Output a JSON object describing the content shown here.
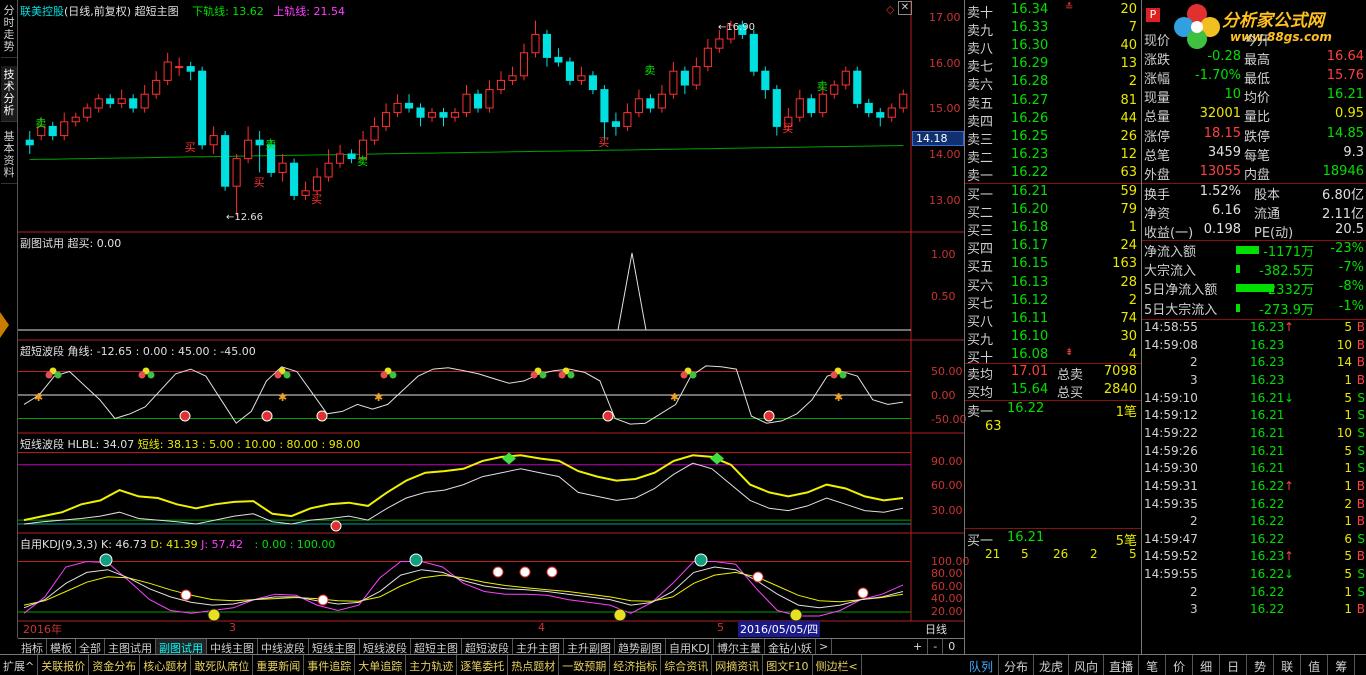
{
  "app": {
    "title": "联美控股",
    "subtitle": "(日线,前复权) 超短主图",
    "lower_label": "下轨线: 13.62",
    "upper_label": "上轨线: 21.54",
    "cur_price_tag": "14.18",
    "price_axis": [
      "17.00",
      "16.00",
      "15.00",
      "14.00",
      "13.00"
    ],
    "high_mark": "16.90",
    "low_mark": "12.66",
    "buy_sell": {
      "buy": "买",
      "sell": "卖"
    }
  },
  "left_tabs": [
    "分时走势",
    "技术分析",
    "基本资料"
  ],
  "panels": {
    "sub1": {
      "name": "副图试用",
      "value": "超买: 0.00",
      "axis": [
        "1.00",
        "0.50"
      ]
    },
    "sub2": {
      "name": "超短波段",
      "value": "角线: -12.65 : 0.00 : 45.00 : -45.00",
      "axis": [
        "50.00",
        "0.00",
        "-50.00"
      ]
    },
    "sub3": {
      "name": "短线波段",
      "value": "HLBL: 34.07",
      "value2": "短线: 38.13 : 5.00 : 10.00 : 80.00 : 98.00",
      "axis": [
        "90.00",
        "60.00",
        "30.00"
      ]
    },
    "sub4": {
      "name": "自用KDJ(9,3,3)",
      "k": "K: 46.73",
      "d": "D: 41.39",
      "j": "J: 57.42",
      "extra": ": 0.00 : 100.00",
      "axis": [
        "100.00",
        "80.00",
        "60.00",
        "40.00",
        "20.00"
      ]
    }
  },
  "time_axis": {
    "year": "2016年",
    "m3": "3",
    "m4": "4",
    "m5": "5",
    "date_box": "2016/05/05/四",
    "period": "日线"
  },
  "bottom_tabs": [
    "指标",
    "模板",
    "全部",
    "主图试用",
    "副图试用",
    "中线主图",
    "中线波段",
    "短线主图",
    "短线波段",
    "超短主图",
    "超短波段",
    "主升主图",
    "主升副图",
    "趋势副图",
    "自用KDJ",
    "博尔主量",
    "金钻小妖"
  ],
  "bottom_active": "副图试用",
  "status_bar": [
    "扩展^",
    "关联报价",
    "资金分布",
    "核心题材",
    "敢死队席位",
    "重要新闻",
    "事件追踪",
    "大单追踪",
    "主力轨迹",
    "逐笔委托",
    "热点题材",
    "一致预期",
    "经济指标",
    "综合资讯",
    "网摘资讯",
    "图文F10",
    "侧边栏<"
  ],
  "sell_orders": [
    {
      "label": "卖十",
      "price": "16.34",
      "vol": "20"
    },
    {
      "label": "卖九",
      "price": "16.33",
      "vol": "7"
    },
    {
      "label": "卖八",
      "price": "16.30",
      "vol": "40"
    },
    {
      "label": "卖七",
      "price": "16.29",
      "vol": "13"
    },
    {
      "label": "卖六",
      "price": "16.28",
      "vol": "2"
    },
    {
      "label": "卖五",
      "price": "16.27",
      "vol": "81"
    },
    {
      "label": "卖四",
      "price": "16.26",
      "vol": "44"
    },
    {
      "label": "卖三",
      "price": "16.25",
      "vol": "26"
    },
    {
      "label": "卖二",
      "price": "16.23",
      "vol": "12"
    },
    {
      "label": "卖一",
      "price": "16.22",
      "vol": "63"
    }
  ],
  "buy_orders": [
    {
      "label": "买一",
      "price": "16.21",
      "vol": "59"
    },
    {
      "label": "买二",
      "price": "16.20",
      "vol": "79"
    },
    {
      "label": "买三",
      "price": "16.18",
      "vol": "1"
    },
    {
      "label": "买四",
      "price": "16.17",
      "vol": "24"
    },
    {
      "label": "买五",
      "price": "16.15",
      "vol": "163"
    },
    {
      "label": "买六",
      "price": "16.13",
      "vol": "28"
    },
    {
      "label": "买七",
      "price": "16.12",
      "vol": "2"
    },
    {
      "label": "买八",
      "price": "16.11",
      "vol": "74"
    },
    {
      "label": "买九",
      "price": "16.10",
      "vol": "30"
    },
    {
      "label": "买十",
      "price": "16.08",
      "vol": "4"
    }
  ],
  "avg": {
    "sell_avg_label": "卖均",
    "sell_avg": "17.01",
    "total_sell_label": "总卖",
    "total_sell": "7098",
    "buy_avg_label": "买均",
    "buy_avg": "15.64",
    "total_buy_label": "总买",
    "total_buy": "2840"
  },
  "queue": {
    "sell1_label": "卖一",
    "sell1_price": "16.22",
    "sell1_count": "1笔",
    "sell1_vol": "63",
    "buy1_label": "买一",
    "buy1_price": "16.21",
    "buy1_count": "5笔",
    "buy1_vols": [
      "21",
      "5",
      "26",
      "2",
      "5"
    ]
  },
  "logo": {
    "text": "分析家公式网",
    "url": "www.88gs.com"
  },
  "stats": [
    {
      "l1": "现价",
      "v1": "",
      "l2": "今开",
      "v2": ""
    },
    {
      "l1": "涨跌",
      "v1": "-0.28",
      "l2": "最高",
      "v2": "16.64"
    },
    {
      "l1": "涨幅",
      "v1": "-1.70%",
      "l2": "最低",
      "v2": "15.76"
    },
    {
      "l1": "现量",
      "v1": "10",
      "l2": "均价",
      "v2": "16.21"
    },
    {
      "l1": "总量",
      "v1": "32001",
      "l2": "量比",
      "v2": "0.95"
    },
    {
      "l1": "涨停",
      "v1": "18.15",
      "l2": "跌停",
      "v2": "14.85"
    },
    {
      "l1": "总笔",
      "v1": "3459",
      "l2": "每笔",
      "v2": "9.3"
    },
    {
      "l1": "外盘",
      "v1": "13055",
      "l2": "内盘",
      "v2": "18946"
    }
  ],
  "stats2": [
    {
      "l1": "换手",
      "v1": "1.52%",
      "l2": "股本",
      "v2": "6.80亿"
    },
    {
      "l1": "净资",
      "v1": "6.16",
      "l2": "流通",
      "v2": "2.11亿"
    },
    {
      "l1": "收益(一)",
      "v1": "0.198",
      "l2": "PE(动)",
      "v2": "20.5"
    }
  ],
  "flows": [
    {
      "label": "净流入额",
      "value": "-1171万",
      "pct": "-23%",
      "bar": 0.6
    },
    {
      "label": "大宗流入",
      "value": "-382.5万",
      "pct": "-7%",
      "bar": 0.1
    },
    {
      "label": "5日净流入额",
      "value": "-2332万",
      "pct": "-8%",
      "bar": 1.0
    },
    {
      "label": "5日大宗流入",
      "value": "-273.9万",
      "pct": "-1%",
      "bar": 0.1
    }
  ],
  "ticks": [
    {
      "time": "14:58:55",
      "price": "16.23",
      "dir": "↑",
      "vol": "5",
      "side": "B"
    },
    {
      "time": "14:59:08",
      "price": "16.23",
      "dir": "",
      "vol": "10",
      "side": "B"
    },
    {
      "time": "2",
      "price": "16.23",
      "dir": "",
      "vol": "14",
      "side": "B"
    },
    {
      "time": "3",
      "price": "16.23",
      "dir": "",
      "vol": "1",
      "side": "B"
    },
    {
      "time": "14:59:10",
      "price": "16.21",
      "dir": "↓",
      "vol": "5",
      "side": "S"
    },
    {
      "time": "14:59:12",
      "price": "16.21",
      "dir": "",
      "vol": "1",
      "side": "S"
    },
    {
      "time": "14:59:22",
      "price": "16.21",
      "dir": "",
      "vol": "10",
      "side": "S"
    },
    {
      "time": "14:59:26",
      "price": "16.21",
      "dir": "",
      "vol": "5",
      "side": "S"
    },
    {
      "time": "14:59:30",
      "price": "16.21",
      "dir": "",
      "vol": "1",
      "side": "S"
    },
    {
      "time": "14:59:31",
      "price": "16.22",
      "dir": "↑",
      "vol": "1",
      "side": "B"
    },
    {
      "time": "14:59:35",
      "price": "16.22",
      "dir": "",
      "vol": "2",
      "side": "B"
    },
    {
      "time": "2",
      "price": "16.22",
      "dir": "",
      "vol": "1",
      "side": "B"
    },
    {
      "time": "14:59:47",
      "price": "16.22",
      "dir": "",
      "vol": "6",
      "side": "S"
    },
    {
      "time": "14:59:52",
      "price": "16.23",
      "dir": "↑",
      "vol": "5",
      "side": "B"
    },
    {
      "time": "14:59:55",
      "price": "16.22",
      "dir": "↓",
      "vol": "5",
      "side": "S"
    },
    {
      "time": "2",
      "price": "16.22",
      "dir": "",
      "vol": "1",
      "side": "S"
    },
    {
      "time": "3",
      "price": "16.22",
      "dir": "",
      "vol": "1",
      "side": "B"
    }
  ],
  "right_tabs": [
    "队列",
    "分布",
    "龙虎",
    "风向",
    "直播",
    "笔",
    "价",
    "细",
    "日",
    "势",
    "联",
    "值",
    "筹"
  ],
  "right_tab_active": "队列",
  "colors": {
    "up": "#ff4040",
    "down": "#00e0e0",
    "ma": "#00b000",
    "bg": "#000000"
  },
  "candles": [
    [
      14.3,
      14.2,
      14.5,
      14.0
    ],
    [
      14.4,
      14.6,
      14.8,
      14.3
    ],
    [
      14.6,
      14.4,
      14.7,
      14.3
    ],
    [
      14.4,
      14.7,
      14.9,
      14.3
    ],
    [
      14.7,
      14.8,
      14.9,
      14.6
    ],
    [
      14.8,
      15.0,
      15.1,
      14.7
    ],
    [
      15.0,
      15.2,
      15.3,
      14.9
    ],
    [
      15.2,
      15.1,
      15.3,
      15.0
    ],
    [
      15.1,
      15.2,
      15.4,
      15.0
    ],
    [
      15.2,
      15.0,
      15.3,
      14.9
    ],
    [
      15.0,
      15.3,
      15.5,
      14.9
    ],
    [
      15.3,
      15.6,
      15.8,
      15.2
    ],
    [
      15.6,
      16.0,
      16.2,
      15.5
    ],
    [
      15.9,
      15.9,
      16.1,
      15.7
    ],
    [
      15.9,
      15.8,
      16.0,
      15.6
    ],
    [
      15.8,
      14.2,
      15.9,
      14.1
    ],
    [
      14.2,
      14.4,
      14.6,
      14.0
    ],
    [
      14.4,
      13.3,
      14.5,
      13.2
    ],
    [
      13.3,
      13.9,
      14.0,
      12.66
    ],
    [
      13.9,
      14.3,
      14.6,
      13.8
    ],
    [
      14.3,
      14.2,
      14.5,
      13.6
    ],
    [
      14.2,
      13.6,
      14.3,
      13.5
    ],
    [
      13.6,
      13.8,
      14.0,
      13.4
    ],
    [
      13.8,
      13.1,
      13.9,
      13.0
    ],
    [
      13.1,
      13.2,
      13.4,
      13.0
    ],
    [
      13.2,
      13.5,
      13.7,
      13.1
    ],
    [
      13.5,
      13.8,
      14.1,
      13.4
    ],
    [
      13.8,
      14.0,
      14.2,
      13.7
    ],
    [
      14.0,
      13.9,
      14.1,
      13.8
    ],
    [
      13.9,
      14.3,
      14.5,
      13.8
    ],
    [
      14.3,
      14.6,
      14.8,
      14.2
    ],
    [
      14.6,
      14.9,
      15.1,
      14.5
    ],
    [
      14.9,
      15.1,
      15.3,
      14.8
    ],
    [
      15.1,
      15.0,
      15.3,
      14.9
    ],
    [
      15.0,
      14.8,
      15.1,
      14.6
    ],
    [
      14.8,
      14.9,
      15.0,
      14.7
    ],
    [
      14.9,
      14.8,
      15.0,
      14.6
    ],
    [
      14.8,
      14.9,
      15.0,
      14.7
    ],
    [
      14.9,
      15.3,
      15.5,
      14.8
    ],
    [
      15.3,
      15.0,
      15.4,
      14.9
    ],
    [
      15.0,
      15.4,
      15.6,
      14.9
    ],
    [
      15.4,
      15.6,
      15.8,
      15.3
    ],
    [
      15.6,
      15.7,
      15.9,
      15.5
    ],
    [
      15.7,
      16.2,
      16.4,
      15.6
    ],
    [
      16.2,
      16.6,
      16.9,
      16.1
    ],
    [
      16.6,
      16.1,
      16.7,
      15.9
    ],
    [
      16.1,
      16.0,
      16.3,
      15.9
    ],
    [
      16.0,
      15.6,
      16.1,
      15.5
    ],
    [
      15.6,
      15.7,
      15.9,
      15.5
    ],
    [
      15.7,
      15.4,
      15.8,
      15.3
    ],
    [
      15.4,
      14.7,
      15.5,
      14.3
    ],
    [
      14.7,
      14.6,
      14.9,
      14.4
    ],
    [
      14.6,
      14.9,
      15.1,
      14.5
    ],
    [
      14.9,
      15.2,
      15.4,
      14.8
    ],
    [
      15.2,
      15.0,
      15.3,
      14.9
    ],
    [
      15.0,
      15.3,
      15.5,
      14.9
    ],
    [
      15.3,
      15.8,
      16.0,
      15.2
    ],
    [
      15.8,
      15.5,
      15.9,
      15.3
    ],
    [
      15.5,
      15.9,
      16.1,
      15.4
    ],
    [
      15.9,
      16.3,
      16.5,
      15.8
    ],
    [
      16.3,
      16.5,
      16.7,
      16.2
    ],
    [
      16.5,
      16.8,
      16.9,
      16.4
    ],
    [
      16.8,
      16.6,
      16.9,
      16.5
    ],
    [
      16.6,
      15.8,
      16.7,
      15.7
    ],
    [
      15.8,
      15.4,
      15.9,
      15.2
    ],
    [
      15.4,
      14.6,
      15.5,
      14.4
    ],
    [
      14.6,
      14.8,
      15.0,
      14.5
    ],
    [
      14.8,
      15.2,
      15.4,
      14.7
    ],
    [
      15.2,
      14.9,
      15.3,
      14.8
    ],
    [
      14.9,
      15.3,
      15.5,
      14.8
    ],
    [
      15.3,
      15.5,
      15.6,
      15.2
    ],
    [
      15.5,
      15.8,
      15.9,
      15.4
    ],
    [
      15.8,
      15.1,
      15.9,
      15.0
    ],
    [
      15.1,
      14.9,
      15.2,
      14.8
    ],
    [
      14.9,
      14.8,
      15.0,
      14.6
    ],
    [
      14.8,
      15.0,
      15.1,
      14.7
    ],
    [
      15.0,
      15.3,
      15.4,
      14.9
    ]
  ]
}
